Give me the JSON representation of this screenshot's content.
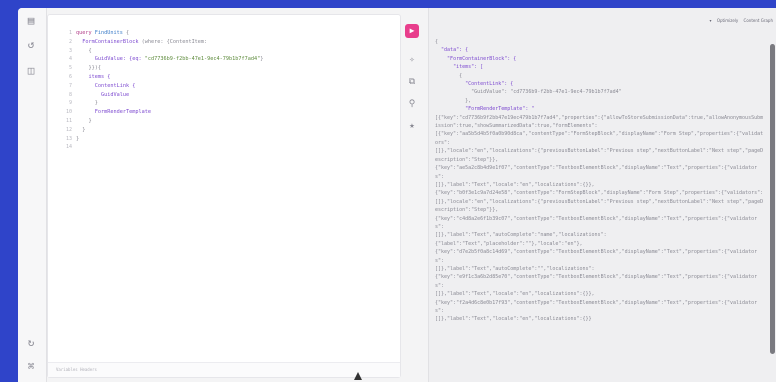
{
  "rail": {
    "icons": [
      "docs-icon",
      "history-icon",
      "folder-icon",
      "refresh-icon",
      "shortcuts-icon"
    ]
  },
  "editor": {
    "lines": [
      {
        "t": "1",
        "segments": [
          {
            "c": "kw",
            "v": "query "
          },
          {
            "c": "fn",
            "v": "FindUnits "
          },
          {
            "c": "pun",
            "v": "{"
          }
        ]
      },
      {
        "t": "2",
        "segments": [
          {
            "c": "",
            "v": "  FormContainerBlock "
          },
          {
            "c": "pun",
            "v": "(where: {ContentItem:"
          }
        ]
      },
      {
        "t": "3",
        "segments": [
          {
            "c": "pun",
            "v": "    {"
          }
        ]
      },
      {
        "t": "4",
        "segments": [
          {
            "c": "",
            "v": "      GuidValue: {eq: "
          },
          {
            "c": "str",
            "v": "\"cd7736b9-f2bb-47e1-9ec4-79b1b7f7ad4\""
          },
          {
            "c": "pun",
            "v": "}"
          }
        ]
      },
      {
        "t": "5",
        "segments": [
          {
            "c": "pun",
            "v": "    }}){"
          }
        ]
      },
      {
        "t": "6",
        "segments": [
          {
            "c": "",
            "v": "    items {"
          }
        ]
      },
      {
        "t": "7",
        "segments": [
          {
            "c": "",
            "v": "      ContentLink {"
          }
        ]
      },
      {
        "t": "8",
        "segments": [
          {
            "c": "",
            "v": "        GuidValue"
          }
        ]
      },
      {
        "t": "9",
        "segments": [
          {
            "c": "pun",
            "v": "      }"
          }
        ]
      },
      {
        "t": "10",
        "segments": [
          {
            "c": "",
            "v": "      FormRenderTemplate"
          }
        ]
      },
      {
        "t": "11",
        "segments": [
          {
            "c": "pun",
            "v": "    }"
          }
        ]
      },
      {
        "t": "12",
        "segments": [
          {
            "c": "pun",
            "v": "  }"
          }
        ]
      },
      {
        "t": "13",
        "segments": [
          {
            "c": "pun",
            "v": "}"
          }
        ]
      },
      {
        "t": "14",
        "segments": [
          {
            "c": "",
            "v": ""
          }
        ]
      }
    ],
    "footer_label": "Variables  Headers"
  },
  "tools": {
    "run_label": "▶"
  },
  "result": {
    "top_right": [
      "▾",
      "Optimizely",
      "Content Graph"
    ],
    "lines": [
      {
        "k": "rs",
        "v": "{"
      },
      {
        "k": "rk",
        "v": "  \"data\": {"
      },
      {
        "k": "rk",
        "v": "    \"FormContainerBlock\": {"
      },
      {
        "k": "rk",
        "v": "      \"items\": ["
      },
      {
        "k": "rs",
        "v": "        {"
      },
      {
        "k": "rk",
        "v": "          \"ContentLink\": {"
      },
      {
        "k": "rs",
        "v": "            \"GuidValue\": \"cd7736b9-f2bb-47e1-9ec4-79b1b7f7ad4\""
      },
      {
        "k": "rs",
        "v": "          },"
      },
      {
        "k": "rk",
        "v": "          \"FormRenderTemplate\": \""
      },
      {
        "k": "rs",
        "v": "[{\"key\":\"cd7736b9f2bb47e19ec479b1b7f7ad4\",\"properties\":{\"allowToStoreSubmissionData\":true,\"allowAnonymousSubmission\":true,\"showSummarizedData\":true,\"formElements\":"
      },
      {
        "k": "rs",
        "v": "[{\"key\":\"aa5b5d4b5f0a0b90d8ca\",\"contentType\":\"FormStepBlock\",\"displayName\":\"Form Step\",\"properties\":{\"validators\":"
      },
      {
        "k": "rs",
        "v": "[]},\"locale\":\"en\",\"localizations\":{\"previousButtonLabel\":\"Previous step\",\"nextButtonLabel\":\"Next step\",\"pageDescription\":\"Step\"}},"
      },
      {
        "k": "rs",
        "v": "{\"key\":\"ae5a2c8b4d9e1f07\",\"contentType\":\"TextboxElementBlock\",\"displayName\":\"Text\",\"properties\":{\"validators\":"
      },
      {
        "k": "rs",
        "v": "[]},\"label\":\"Text\",\"locale\":\"en\",\"localizations\":{}},"
      },
      {
        "k": "rs",
        "v": "{\"key\":\"b0f3e1c9a7d24e58\",\"contentType\":\"FormStepBlock\",\"displayName\":\"Form Step\",\"properties\":{\"validators\":"
      },
      {
        "k": "rs",
        "v": "[]},\"locale\":\"en\",\"localizations\":{\"previousButtonLabel\":\"Previous step\",\"nextButtonLabel\":\"Next step\",\"pageDescription\":\"Step\"}},"
      },
      {
        "k": "rs",
        "v": "{\"key\":\"c4d8a2e6f1b39c07\",\"contentType\":\"TextboxElementBlock\",\"displayName\":\"Text\",\"properties\":{\"validators\":"
      },
      {
        "k": "rs",
        "v": "[]},\"label\":\"Text\",\"autoComplete\":\"name\",\"localizations\":"
      },
      {
        "k": "rs",
        "v": "{\"label\":\"Text\",\"placeholder\":\"\"},\"locale\":\"en\"},"
      },
      {
        "k": "rs",
        "v": "{\"key\":\"d7e2b5f0a8c14d69\",\"contentType\":\"TextboxElementBlock\",\"displayName\":\"Text\",\"properties\":{\"validators\":"
      },
      {
        "k": "rs",
        "v": "[]},\"label\":\"Text\",\"autoComplete\":\"\",\"localizations\":"
      },
      {
        "k": "rs",
        "v": "{\"key\":\"e9f1c3a6b2d85e70\",\"contentType\":\"TextboxElementBlock\",\"displayName\":\"Text\",\"properties\":{\"validators\":"
      },
      {
        "k": "rs",
        "v": "[]},\"label\":\"Text\",\"locale\":\"en\",\"localizations\":{}},"
      },
      {
        "k": "rs",
        "v": "{\"key\":\"f2a4d6c8e0b17f93\",\"contentType\":\"TextboxElementBlock\",\"displayName\":\"Text\",\"properties\":{\"validators\":"
      },
      {
        "k": "rs",
        "v": "[]},\"label\":\"Text\",\"locale\":\"en\",\"localizations\":{}}"
      }
    ]
  }
}
